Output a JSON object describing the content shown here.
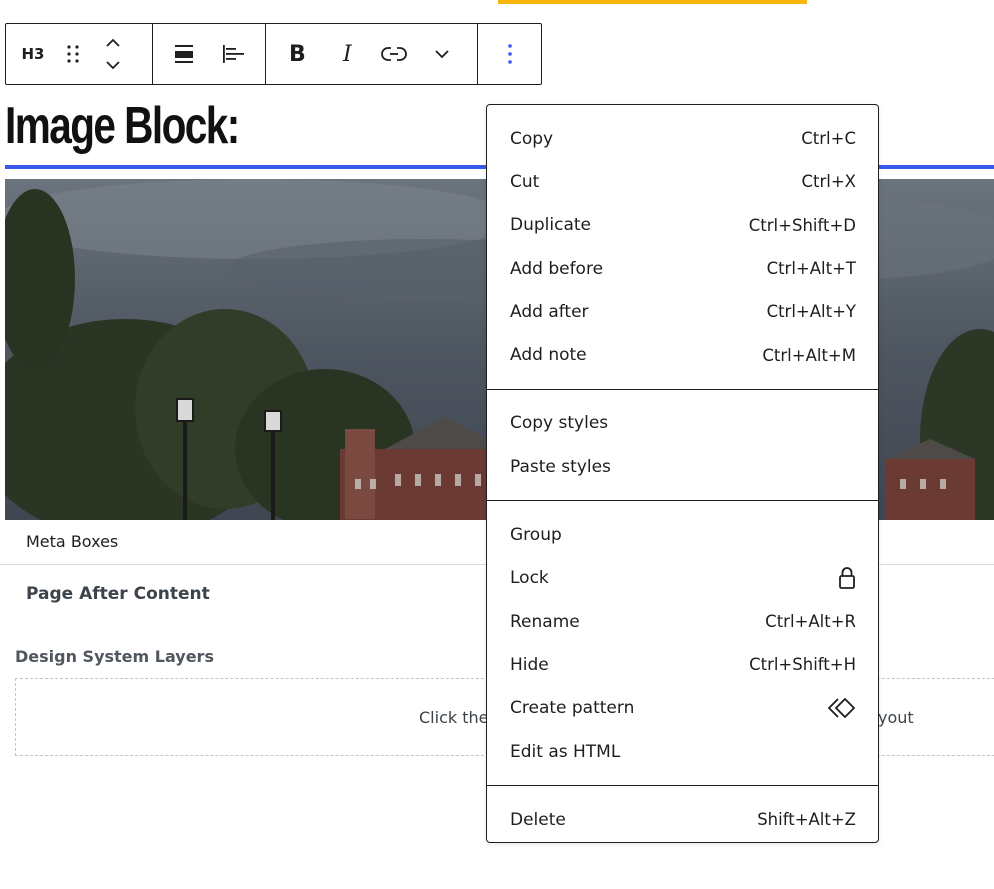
{
  "toolbar": {
    "heading_level": "H3",
    "icons": [
      "drag-handle-icon",
      "move-up-down-icon",
      "align-wide-icon",
      "align-text-left-icon",
      "bold-icon",
      "italic-icon",
      "link-icon",
      "chevron-down-icon",
      "more-options-icon"
    ]
  },
  "page": {
    "heading": "Image Block:",
    "accent_color": "#3858e9",
    "highlight_color": "#f6b60c"
  },
  "meta": {
    "title": "Meta Boxes",
    "after_content": "Page After Content",
    "layers_title": "Design System Layers",
    "layers_hint_left": "Click the",
    "layers_hint_right": "yout"
  },
  "menu": {
    "groups": [
      [
        {
          "label": "Copy",
          "shortcut": "Ctrl+C"
        },
        {
          "label": "Cut",
          "shortcut": "Ctrl+X"
        },
        {
          "label": "Duplicate",
          "shortcut": "Ctrl+Shift+D"
        },
        {
          "label": "Add before",
          "shortcut": "Ctrl+Alt+T"
        },
        {
          "label": "Add after",
          "shortcut": "Ctrl+Alt+Y"
        },
        {
          "label": "Add note",
          "shortcut": "Ctrl+Alt+M"
        }
      ],
      [
        {
          "label": "Copy styles",
          "shortcut": ""
        },
        {
          "label": "Paste styles",
          "shortcut": ""
        }
      ],
      [
        {
          "label": "Group",
          "shortcut": ""
        },
        {
          "label": "Lock",
          "shortcut": "",
          "icon": "lock-icon"
        },
        {
          "label": "Rename",
          "shortcut": "Ctrl+Alt+R"
        },
        {
          "label": "Hide",
          "shortcut": "Ctrl+Shift+H"
        },
        {
          "label": "Create pattern",
          "shortcut": "",
          "icon": "symbol-icon"
        },
        {
          "label": "Edit as HTML",
          "shortcut": ""
        }
      ],
      [
        {
          "label": "Delete",
          "shortcut": "Shift+Alt+Z"
        }
      ]
    ]
  }
}
